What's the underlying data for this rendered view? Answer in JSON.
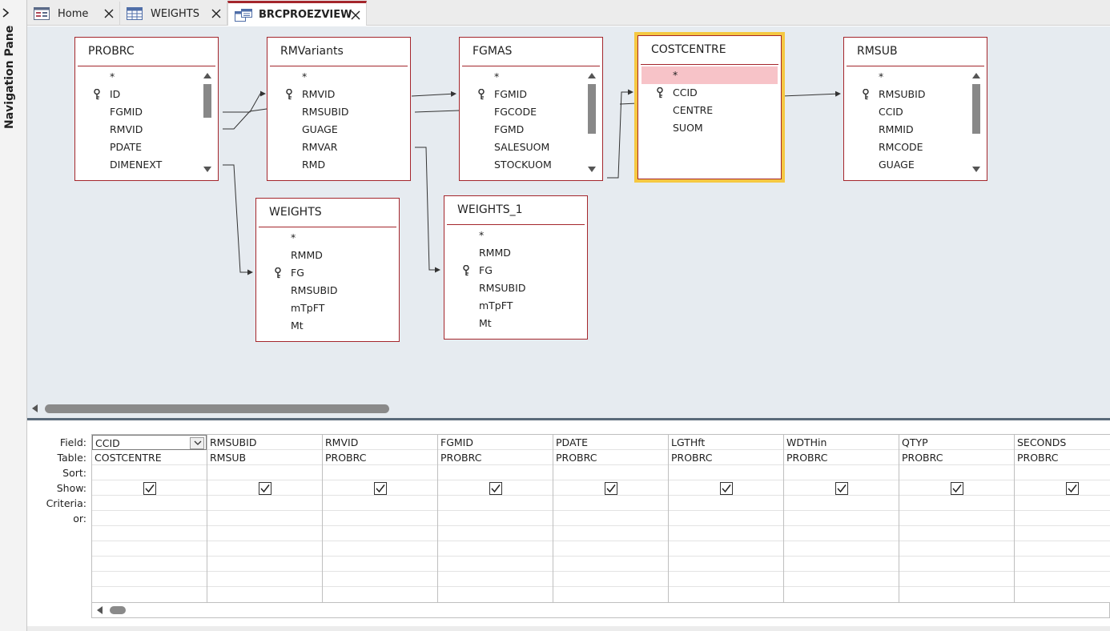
{
  "nav_pane": {
    "label": "Navigation Pane"
  },
  "tabs": [
    {
      "label": "Home",
      "icon": "form-icon",
      "active": false
    },
    {
      "label": "WEIGHTS",
      "icon": "table-icon",
      "active": false
    },
    {
      "label": "BRCPROEZVIEW",
      "icon": "query-icon",
      "active": true
    }
  ],
  "tables": [
    {
      "title": "PROBRC",
      "fields": [
        "*",
        "ID",
        "FGMID",
        "RMVID",
        "PDATE",
        "DIMENEXT"
      ],
      "key_fields": [
        "ID"
      ],
      "scroll": {
        "fraction_start": 0.1,
        "fraction_size": 0.32
      }
    },
    {
      "title": "RMVariants",
      "fields": [
        "*",
        "RMVID",
        "RMSUBID",
        "GUAGE",
        "RMVAR",
        "RMD"
      ],
      "key_fields": [
        "RMVID"
      ]
    },
    {
      "title": "FGMAS",
      "fields": [
        "*",
        "FGMID",
        "FGCODE",
        "FGMD",
        "SALESUOM",
        "STOCKUOM"
      ],
      "key_fields": [
        "FGMID"
      ],
      "scroll": {
        "fraction_start": 0.1,
        "fraction_size": 0.62
      }
    },
    {
      "title": "COSTCENTRE",
      "fields": [
        "*",
        "CCID",
        "CENTRE",
        "SUOM"
      ],
      "key_fields": [
        "CCID"
      ],
      "selected": true,
      "highlighted_field": "*"
    },
    {
      "title": "RMSUB",
      "fields": [
        "*",
        "RMSUBID",
        "CCID",
        "RMMID",
        "RMCODE",
        "GUAGE"
      ],
      "key_fields": [
        "RMSUBID"
      ],
      "scroll": {
        "fraction_start": 0.1,
        "fraction_size": 0.62
      }
    },
    {
      "title": "WEIGHTS",
      "fields": [
        "*",
        "RMMD",
        "FG",
        "RMSUBID",
        "mTpFT",
        "Mt"
      ],
      "key_fields": [
        "FG"
      ]
    },
    {
      "title": "WEIGHTS_1",
      "fields": [
        "*",
        "RMMD",
        "FG",
        "RMSUBID",
        "mTpFT",
        "Mt"
      ],
      "key_fields": [
        "FG"
      ]
    }
  ],
  "grid": {
    "row_labels": [
      "Field:",
      "Table:",
      "Sort:",
      "Show:",
      "Criteria:",
      "or:"
    ],
    "columns": [
      {
        "field": "CCID",
        "table": "COSTCENTRE",
        "show": true
      },
      {
        "field": "RMSUBID",
        "table": "RMSUB",
        "show": true
      },
      {
        "field": "RMVID",
        "table": "PROBRC",
        "show": true
      },
      {
        "field": "FGMID",
        "table": "PROBRC",
        "show": true
      },
      {
        "field": "PDATE",
        "table": "PROBRC",
        "show": true
      },
      {
        "field": "LGTHft",
        "table": "PROBRC",
        "show": true
      },
      {
        "field": "WDTHin",
        "table": "PROBRC",
        "show": true
      },
      {
        "field": "QTYP",
        "table": "PROBRC",
        "show": true
      },
      {
        "field": "SECONDS",
        "table": "PROBRC",
        "show": true
      }
    ]
  },
  "colors": {
    "table_border": "#a4262c",
    "selected_outline": "#f5c842",
    "field_highlight": "#f7c3c8",
    "designer_bg": "#e6ebf0"
  }
}
